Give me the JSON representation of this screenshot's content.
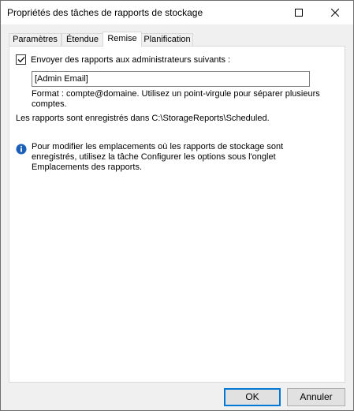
{
  "window": {
    "title": "Propriétés des tâches de rapports de stockage"
  },
  "tabs": [
    {
      "label": "Paramètres",
      "active": false
    },
    {
      "label": "Étendue",
      "active": false
    },
    {
      "label": "Remise",
      "active": true
    },
    {
      "label": "Planification",
      "active": false
    }
  ],
  "delivery": {
    "send_checkbox_label": "Envoyer des rapports aux administrateurs suivants :",
    "send_checked": true,
    "email_value": "[Admin Email]",
    "format_hint": "Format : compte@domaine. Utilisez un point-virgule pour séparer plusieurs comptes.",
    "reports_saved": "Les rapports sont enregistrés dans C:\\StorageReports\\Scheduled.",
    "info_text": "Pour modifier les emplacements où les rapports de stockage sont enregistrés, utilisez la tâche Configurer les options sous l'onglet Emplacements des rapports."
  },
  "buttons": {
    "ok": "OK",
    "cancel": "Annuler"
  },
  "colors": {
    "accent": "#0078d7",
    "info_icon": "#1c5fb8"
  }
}
